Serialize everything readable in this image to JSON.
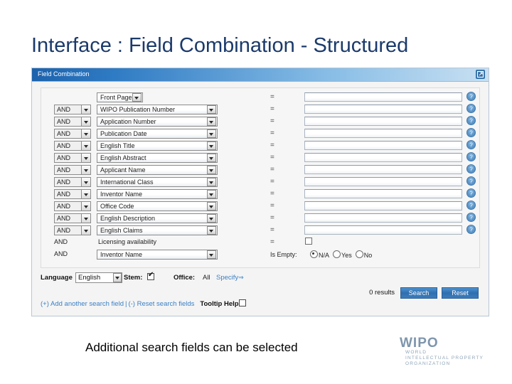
{
  "slide": {
    "title": "Interface : Field Combination - Structured",
    "caption": "Additional search fields can be selected"
  },
  "panel": {
    "title": "Field Combination",
    "maximize_icon": "maximize-icon"
  },
  "form": {
    "operator_symbol": "=",
    "rows": [
      {
        "bool": "",
        "bool_select": false,
        "field": "Front Page",
        "field_select": true,
        "narrow": true,
        "control": "text"
      },
      {
        "bool": "AND",
        "bool_select": true,
        "field": "WIPO Publication Number",
        "field_select": true,
        "narrow": false,
        "control": "text"
      },
      {
        "bool": "AND",
        "bool_select": true,
        "field": "Application Number",
        "field_select": true,
        "narrow": false,
        "control": "text"
      },
      {
        "bool": "AND",
        "bool_select": true,
        "field": "Publication Date",
        "field_select": true,
        "narrow": false,
        "control": "text"
      },
      {
        "bool": "AND",
        "bool_select": true,
        "field": "English Title",
        "field_select": true,
        "narrow": false,
        "control": "text"
      },
      {
        "bool": "AND",
        "bool_select": true,
        "field": "English Abstract",
        "field_select": true,
        "narrow": false,
        "control": "text"
      },
      {
        "bool": "AND",
        "bool_select": true,
        "field": "Applicant Name",
        "field_select": true,
        "narrow": false,
        "control": "text"
      },
      {
        "bool": "AND",
        "bool_select": true,
        "field": "International Class",
        "field_select": true,
        "narrow": false,
        "control": "text"
      },
      {
        "bool": "AND",
        "bool_select": true,
        "field": "Inventor Name",
        "field_select": true,
        "narrow": false,
        "control": "text"
      },
      {
        "bool": "AND",
        "bool_select": true,
        "field": "Office Code",
        "field_select": true,
        "narrow": false,
        "control": "text"
      },
      {
        "bool": "AND",
        "bool_select": true,
        "field": "English Description",
        "field_select": true,
        "narrow": false,
        "control": "text"
      },
      {
        "bool": "AND",
        "bool_select": true,
        "field": "English Claims",
        "field_select": true,
        "narrow": false,
        "control": "text"
      },
      {
        "bool": "AND",
        "bool_select": false,
        "field": "Licensing availability",
        "field_select": false,
        "narrow": false,
        "control": "checkbox"
      },
      {
        "bool": "AND",
        "bool_select": false,
        "field": "Inventor Name",
        "field_select": true,
        "narrow": false,
        "control": "isempty"
      }
    ],
    "is_empty": {
      "label": "Is Empty:",
      "options": [
        {
          "label": "N/A",
          "selected": true
        },
        {
          "label": "Yes",
          "selected": false
        },
        {
          "label": "No",
          "selected": false
        }
      ]
    }
  },
  "options": {
    "language_label": "Language",
    "language_value": "English",
    "stem_label": "Stem:",
    "stem_checked": true,
    "office_label": "Office:",
    "office_value": "All",
    "specify_label": "Specify",
    "specify_arrow": "⇒"
  },
  "results": {
    "count_text": "0 results",
    "search_label": "Search",
    "reset_label": "Reset"
  },
  "links": {
    "add_field": "(+) Add another search field",
    "separator": "|",
    "reset_fields": "(-) Reset search fields",
    "tooltip_help_label": "Tooltip Help"
  },
  "logo": {
    "name": "WIPO",
    "line1": "WORLD",
    "line2": "INTELLECTUAL PROPERTY",
    "line3": "ORGANIZATION"
  },
  "colors": {
    "title_blue": "#1b3a6b",
    "titlebar_blue": "#1c62ac",
    "link_blue": "#3b7fc4",
    "button_blue": "#2f6fb0",
    "logo_gray_blue": "#7e96ad"
  }
}
